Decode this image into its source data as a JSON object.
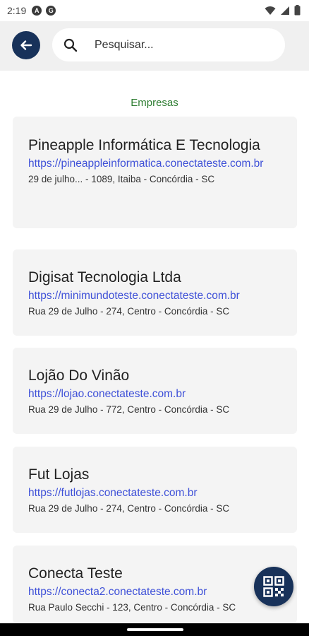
{
  "status_bar": {
    "time": "2:19",
    "app_icons": [
      "A",
      "G"
    ]
  },
  "header": {
    "search_placeholder": "Pesquisar..."
  },
  "section_title": "Empresas",
  "companies": [
    {
      "name": "Pineapple Informática E Tecnologia",
      "url": "https://pineappleinformatica.conectateste.com.br",
      "address": "29 de julho... - 1089, Itaiba - Concórdia - SC"
    },
    {
      "name": "Digisat Tecnologia Ltda",
      "url": "https://minimundoteste.conectateste.com.br",
      "address": "Rua 29 de Julho - 274, Centro - Concórdia - SC"
    },
    {
      "name": "Lojão Do Vinão",
      "url": "https://lojao.conectateste.com.br",
      "address": "Rua 29 de Julho - 772, Centro - Concórdia - SC"
    },
    {
      "name": "Fut Lojas",
      "url": "https://futlojas.conectateste.com.br",
      "address": "Rua 29 de Julho - 274, Centro - Concórdia - SC"
    },
    {
      "name": "Conecta Teste",
      "url": "https://conecta2.conectateste.com.br",
      "address": "Rua Paulo Secchi - 123, Centro - Concórdia - SC"
    }
  ],
  "colors": {
    "primary": "#18325a",
    "accent_green": "#2e7d32",
    "link": "#3f51d8",
    "card_bg": "#f4f4f4"
  },
  "icons": {
    "back": "arrow-left-icon",
    "search": "search-icon",
    "fab": "qr-code-icon"
  }
}
